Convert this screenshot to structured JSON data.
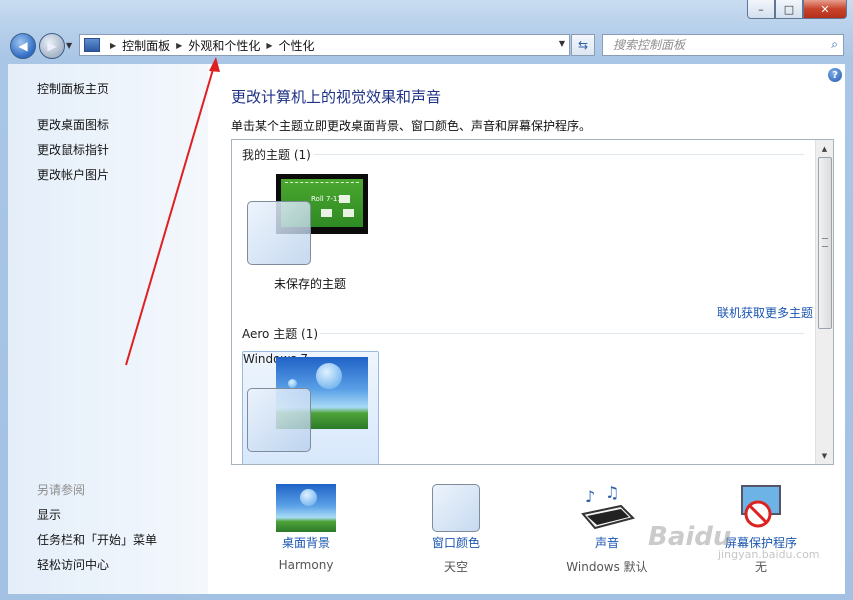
{
  "window": {
    "buttons": {
      "minimize": "–",
      "maximize": "□",
      "close": "✕"
    }
  },
  "nav": {
    "back_icon": "arrow-left",
    "forward_icon": "arrow-right",
    "breadcrumb": [
      "控制面板",
      "外观和个性化",
      "个性化"
    ],
    "search_placeholder": "搜索控制面板"
  },
  "sidebar": {
    "home": "控制面板主页",
    "links": [
      "更改桌面图标",
      "更改鼠标指针",
      "更改帐户图片"
    ],
    "see_also_title": "另请参阅",
    "see_also": [
      "显示",
      "任务栏和「开始」菜单",
      "轻松访问中心"
    ]
  },
  "main": {
    "title": "更改计算机上的视觉效果和声音",
    "description": "单击某个主题立即更改桌面背景、窗口颜色、声音和屏幕保护程序。",
    "groups": [
      {
        "heading": "我的主题 (1)",
        "themes": [
          {
            "name": "未保存的主题"
          }
        ]
      },
      {
        "heading": "Aero 主题 (1)",
        "themes": [
          {
            "name": "Windows 7"
          }
        ]
      }
    ],
    "get_more_link": "联机获取更多主题",
    "thumbnail_text": "Roll 7-11",
    "bottom": [
      {
        "label": "桌面背景",
        "value": "Harmony"
      },
      {
        "label": "窗口颜色",
        "value": "天空"
      },
      {
        "label": "声音",
        "value": "Windows 默认"
      },
      {
        "label": "屏幕保护程序",
        "value": "无"
      }
    ]
  },
  "watermark": {
    "brand": "Baidu",
    "sub": "jingyan.baidu.com"
  },
  "colors": {
    "link": "#1a56b0",
    "title": "#1e3287",
    "annotation_arrow": "#e02020"
  }
}
